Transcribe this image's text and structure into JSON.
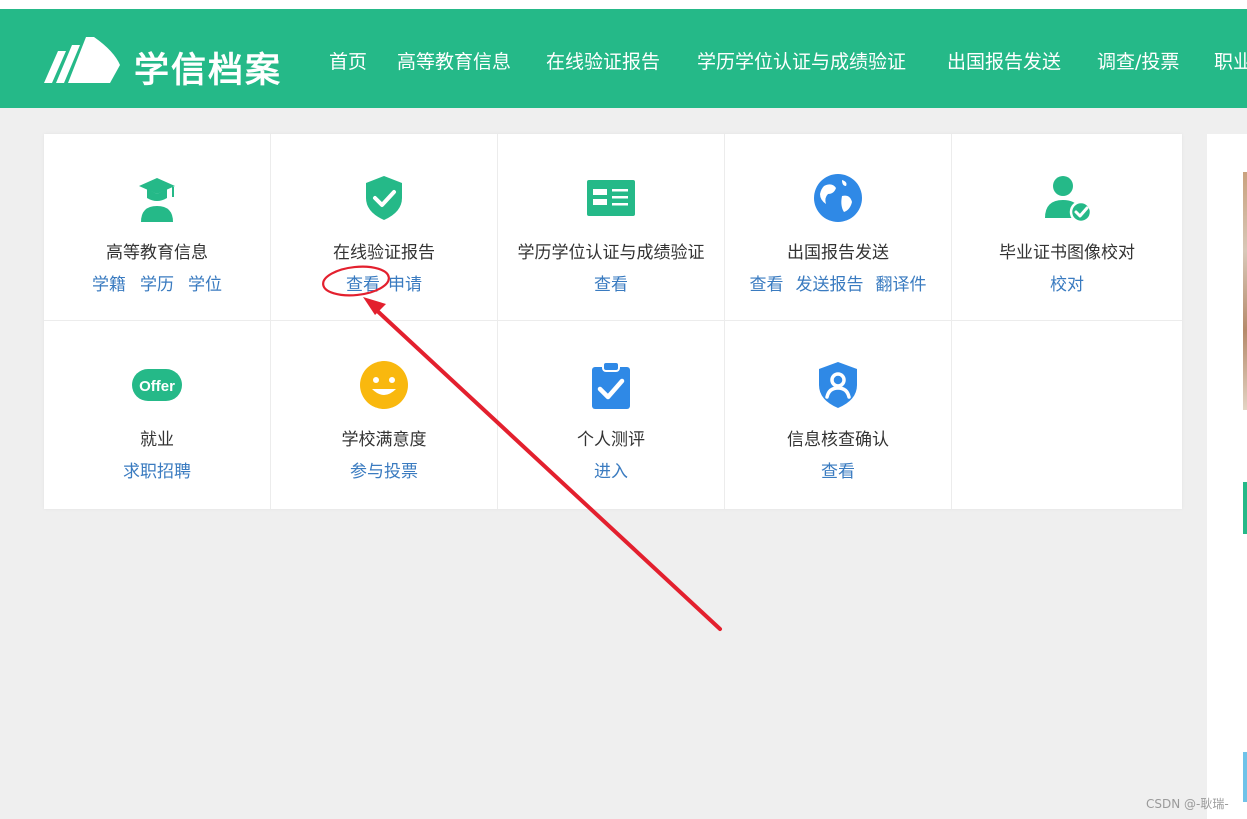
{
  "header": {
    "brand": "学信档案",
    "nav": [
      "首页",
      "高等教育信息",
      "在线验证报告",
      "学历学位认证与成绩验证",
      "出国报告发送",
      "调查/投票",
      "职业"
    ]
  },
  "services": [
    {
      "title": "高等教育信息",
      "icon": "graduate-icon",
      "links": [
        "学籍",
        "学历",
        "学位"
      ]
    },
    {
      "title": "在线验证报告",
      "icon": "shield-check-icon",
      "links": [
        "查看",
        "申请"
      ]
    },
    {
      "title": "学历学位认证与成绩验证",
      "icon": "id-card-icon",
      "links": [
        "查看"
      ]
    },
    {
      "title": "出国报告发送",
      "icon": "globe-icon",
      "links": [
        "查看",
        "发送报告",
        "翻译件"
      ]
    },
    {
      "title": "毕业证书图像校对",
      "icon": "user-check-icon",
      "links": [
        "校对"
      ]
    },
    {
      "title": "就业",
      "icon": "offer-icon",
      "icon_text": "Offer",
      "links": [
        "求职招聘"
      ]
    },
    {
      "title": "学校满意度",
      "icon": "smiley-icon",
      "links": [
        "参与投票"
      ]
    },
    {
      "title": "个人测评",
      "icon": "clipboard-check-icon",
      "links": [
        "进入"
      ]
    },
    {
      "title": "信息核查确认",
      "icon": "shield-user-icon",
      "links": [
        "查看"
      ]
    }
  ],
  "watermark": "CSDN @-耿瑞-",
  "colors": {
    "primary": "#25b988",
    "link": "#3a7bc0",
    "annotation": "#e3202e"
  }
}
